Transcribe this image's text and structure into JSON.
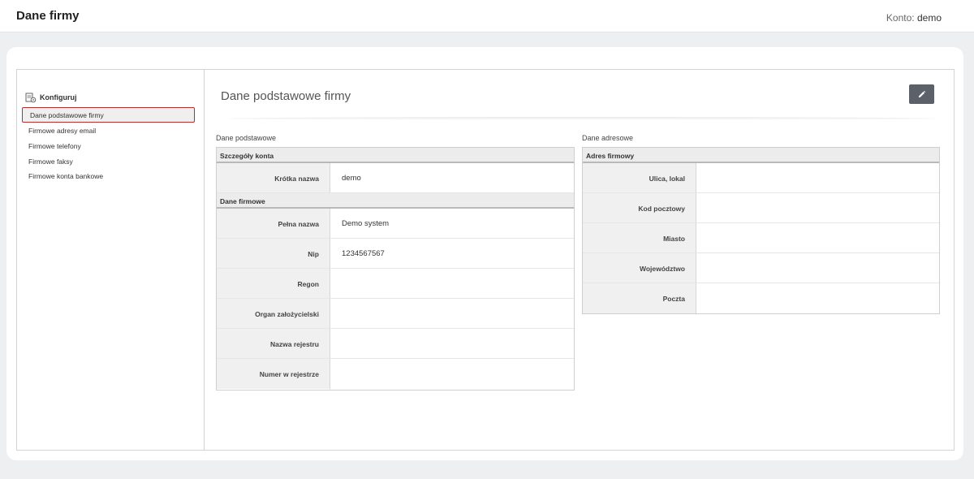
{
  "header": {
    "title": "Dane firmy",
    "account_label": "Konto:",
    "account_name": "demo"
  },
  "sidebar": {
    "heading": "Konfiguruj",
    "items": [
      {
        "label": "Dane podstawowe firmy",
        "active": true
      },
      {
        "label": "Firmowe adresy email"
      },
      {
        "label": "Firmowe telefony"
      },
      {
        "label": "Firmowe faksy"
      },
      {
        "label": "Firmowe konta bankowe"
      }
    ]
  },
  "main": {
    "title": "Dane podstawowe firmy",
    "edit_icon": "pencil-icon",
    "basic": {
      "label": "Dane podstawowe",
      "account_details": {
        "heading": "Szczegóły konta",
        "rows": [
          {
            "key": "Krótka nazwa",
            "value": "demo"
          }
        ]
      },
      "company_data": {
        "heading": "Dane firmowe",
        "rows": [
          {
            "key": "Pełna nazwa",
            "value": "Demo system"
          },
          {
            "key": "Nip",
            "value": "1234567567"
          },
          {
            "key": "Regon",
            "value": ""
          },
          {
            "key": "Organ założycielski",
            "value": ""
          },
          {
            "key": "Nazwa rejestru",
            "value": ""
          },
          {
            "key": "Numer w rejestrze",
            "value": ""
          }
        ]
      }
    },
    "address": {
      "label": "Dane adresowe",
      "company_address": {
        "heading": "Adres firmowy",
        "rows": [
          {
            "key": "Ulica, lokal",
            "value": ""
          },
          {
            "key": "Kod pocztowy",
            "value": ""
          },
          {
            "key": "Miasto",
            "value": ""
          },
          {
            "key": "Województwo",
            "value": ""
          },
          {
            "key": "Poczta",
            "value": ""
          }
        ]
      }
    }
  },
  "colors": {
    "edit_button": "#5c6068",
    "active_border": "#b23030"
  }
}
